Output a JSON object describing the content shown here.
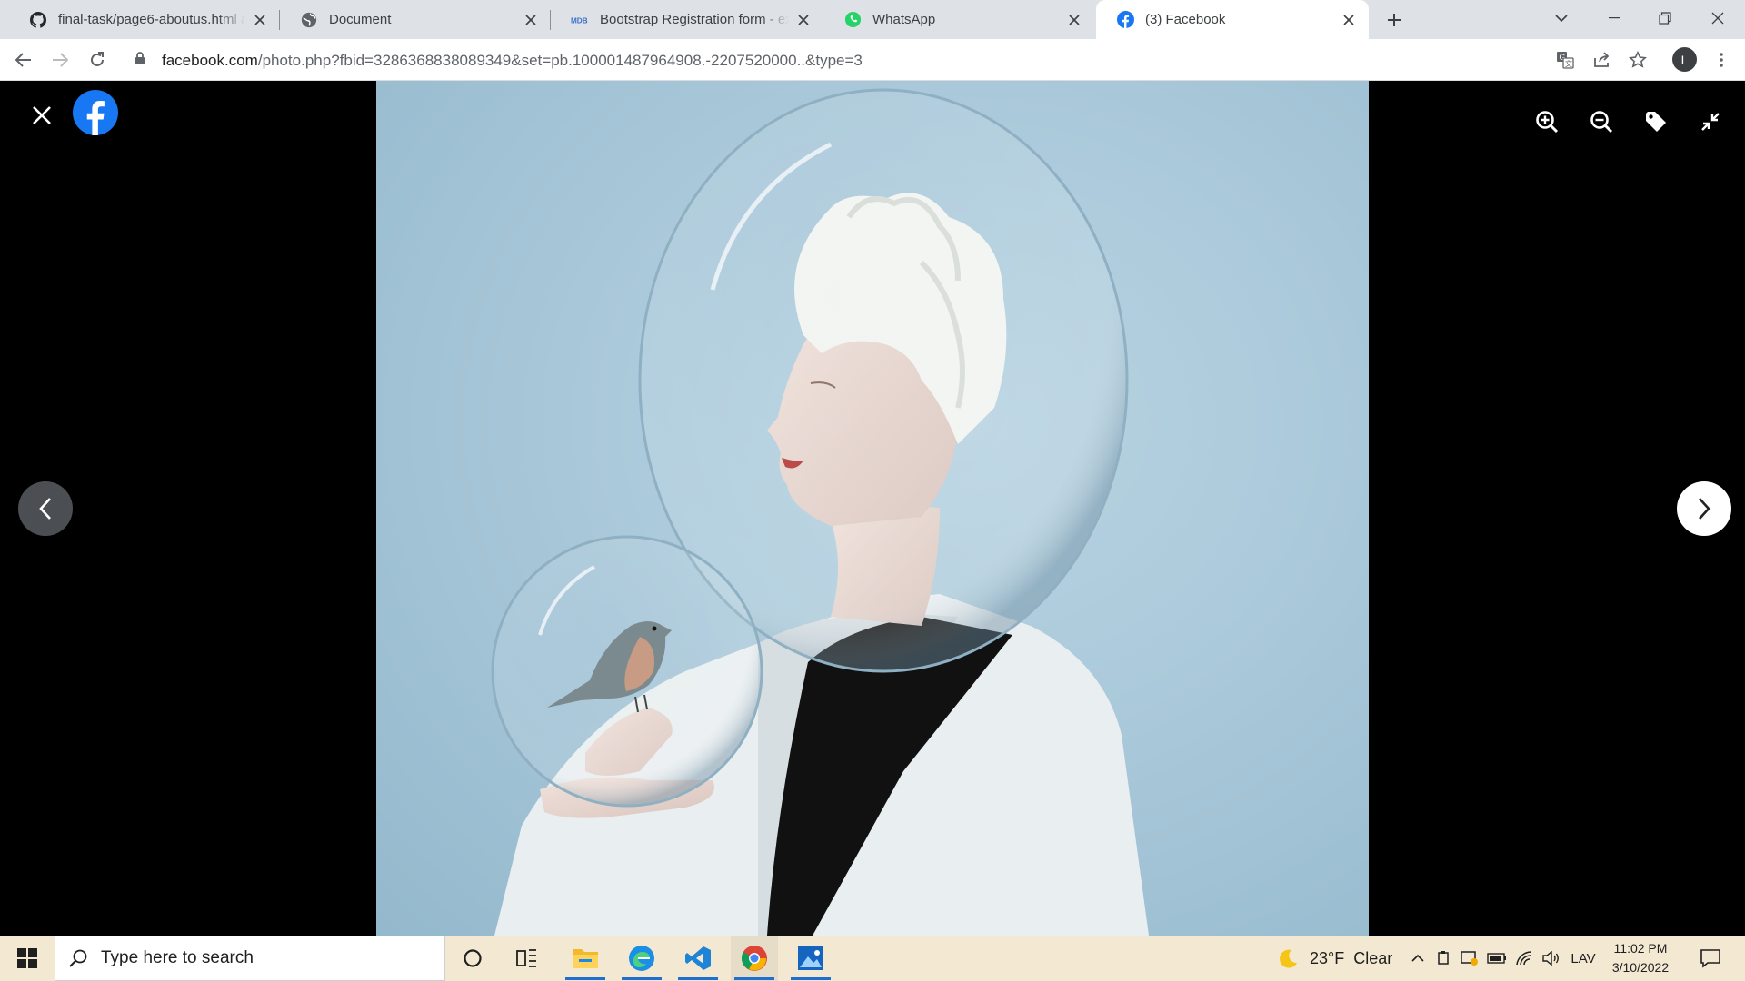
{
  "tabs": [
    {
      "title": "final-task/page6-aboutus.html at",
      "icon": "github-icon",
      "active": false
    },
    {
      "title": "Document",
      "icon": "globe-icon",
      "active": false
    },
    {
      "title": "Bootstrap Registration form - exa",
      "icon": "mdb-icon",
      "active": false
    },
    {
      "title": "WhatsApp",
      "icon": "whatsapp-icon",
      "active": false
    },
    {
      "title": "(3) Facebook",
      "icon": "facebook-icon",
      "active": true
    }
  ],
  "address": {
    "host": "facebook.com",
    "path": "/photo.php?fbid=3286368838089349&set=pb.100001487964908.-2207520000..&type=3"
  },
  "profile_initial": "L",
  "viewer": {
    "photo_description_icon": "photo",
    "controls": [
      "close-icon",
      "facebook-logo-icon",
      "zoom-in-icon",
      "zoom-out-icon",
      "tag-icon",
      "exit-fullscreen-icon"
    ]
  },
  "taskbar": {
    "search_placeholder": "Type here to search",
    "weather": {
      "temp": "23°F",
      "condition": "Clear"
    },
    "language": "LAV",
    "time": "11:02 PM",
    "date": "3/10/2022"
  },
  "colors": {
    "tabstrip": "#dee1e6",
    "facebook_blue": "#1877f2",
    "taskbar": "#f3e9d2",
    "photo_bg": "#a6c6d8"
  }
}
